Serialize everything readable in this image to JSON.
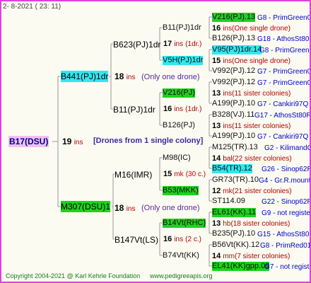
{
  "header": {
    "date": "2- 8-2021",
    "time": "( 23: 11)"
  },
  "root": {
    "name": "B17(DSU)",
    "ins_num": "19",
    "ins_unit": "ins",
    "note": "[Drones from 1 single colony]"
  },
  "gen1": [
    {
      "name": "B441(PJ)1dr",
      "ins_num": "18",
      "ins_unit": "ins",
      "note": "(Only one drone)"
    },
    {
      "name": "M307(DSU)1",
      "ins_num": "18",
      "ins_unit": "ins",
      "note": "(Only one drone)"
    }
  ],
  "gen2": [
    {
      "name": "B623(PJ)1dr",
      "ins_num": "17",
      "ins_unit": "ins",
      "note": "(1dr.)"
    },
    {
      "name": "B11(PJ)1dr",
      "ins_num": "16",
      "ins_unit": "ins",
      "note": "(1dr.)"
    },
    {
      "name": "M16(IMR)",
      "ins_num": "15",
      "ins_unit": "mk",
      "note": "(30 c.)"
    },
    {
      "name": "B147Vt(LS)",
      "ins_num": "16",
      "ins_unit": "ins",
      "note": "(2 c.)"
    }
  ],
  "gen3": [
    {
      "name": "B11(PJ)1dr",
      "ins_num": "",
      "ins_unit": "",
      "note": ""
    },
    {
      "name": "V5H(PJ)1dr",
      "ins_num": "",
      "ins_unit": "",
      "note": ""
    },
    {
      "name": "V216(PJ)",
      "ins_num": "13",
      "ins_unit": "ins",
      "note": "(11 sister colonies)"
    },
    {
      "name": "B126(PJ)",
      "ins_num": "",
      "ins_unit": "",
      "note": ""
    },
    {
      "name": "M98(IC)",
      "ins_num": "14",
      "ins_unit": "bal",
      "note": "(22 sister colonies)"
    },
    {
      "name": "B53(MKK)",
      "ins_num": "12",
      "ins_unit": "mk",
      "note": "(21 sister colonies)"
    },
    {
      "name": "B14Vt(RHC)",
      "ins_num": "13",
      "ins_unit": "hb",
      "note": "(18 sister colonies)"
    },
    {
      "name": "B74Vt(KK)",
      "ins_num": "14",
      "ins_unit": "mm",
      "note": "(7 sister colonies)"
    }
  ],
  "gen4": [
    {
      "name": "V216(PJ).13",
      "ref": "G8 - PrimGreen00"
    },
    {
      "name": "B126(PJ).13",
      "ref": "G18 - AthosSt80R"
    },
    {
      "name": "V95(PJ)1dr.14",
      "ref": "G8 - PrimGreen00"
    },
    {
      "name": "V992(PJ).12",
      "ref": "G7 - PrimGreen00"
    },
    {
      "name": "V992(PJ).12",
      "ref": "G7 - PrimGreen00"
    },
    {
      "name": "A199(PJ).10",
      "ref": "G7 - Cankiri97Q"
    },
    {
      "name": "B328(VJ).11",
      "ref": "G17 - AthosSt80R"
    },
    {
      "name": "A199(PJ).10",
      "ref": "G7 - Cankiri97Q"
    },
    {
      "name": "M125(TR).13",
      "ref": "G2 - KilimandQ"
    },
    {
      "name": "B54(TR).12",
      "ref": "G26 - Sinop62R"
    },
    {
      "name": "GR73(TR).10",
      "ref": "G4 - Gr.R.mounta"
    },
    {
      "name": "ST114.09",
      "ref": "G22 - Sinop62R"
    },
    {
      "name": "EL61(KK).11",
      "ref": "G9 - not registe"
    },
    {
      "name": "B235(PJ).10",
      "ref": "G15 - AthosSt80R"
    },
    {
      "name": "B56Vt(KK).12",
      "ref": "G8 - PrimRed01"
    },
    {
      "name": "EL41(KK)gpp.09",
      "ref": "G7 - not registe"
    }
  ],
  "footer": {
    "copyright": "Copyright 2004-2021 @ Karl Kehrle Foundation",
    "site": "www.pedigreeapis.org"
  }
}
